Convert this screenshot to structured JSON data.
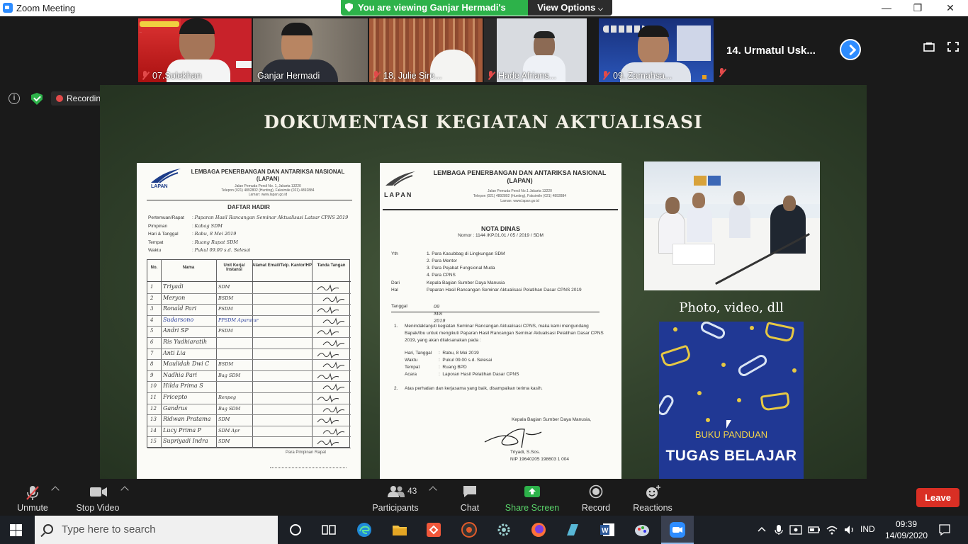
{
  "window": {
    "title": "Zoom Meeting",
    "minimize": "—",
    "maximize": "❐",
    "close": "✕"
  },
  "banner": {
    "viewing_text": "You are viewing Ganjar Hermadi's screen",
    "view_options": "View Options"
  },
  "participants_strip": [
    {
      "name": "07.Solekhan",
      "muted": true
    },
    {
      "name": "Ganjar Hermadi",
      "muted": false,
      "active": true
    },
    {
      "name": "18. Julie Sire...",
      "muted": true
    },
    {
      "name": "Hade Afrians...",
      "muted": true
    },
    {
      "name": "09. Zamahsa...",
      "muted": true
    }
  ],
  "more_participant": "14. Urmatul Usk...",
  "status": {
    "recording": "Recording"
  },
  "slide": {
    "title": "DOKUMENTASI KEGIATAN AKTUALISASI",
    "doc1": {
      "org": "LEMBAGA PENERBANGAN DAN ANTARIKSA NASIONAL",
      "org_abbr": "(LAPAN)",
      "addr1": "Jalan Pemuda Persil No. 1, Jakarta 13220",
      "addr2": "Telepon (021) 4892802 (Hunting), Faksimile (021) 4892884",
      "addr3": "Laman: www.lapan.go.id",
      "logo_text": "LAPAN",
      "heading": "DAFTAR HADIR",
      "fields": [
        {
          "label": "Pertemuan/Rapat",
          "value": "Paparan Hasil Rancangan Seminar Aktualisasi Latsar CPNS 2019"
        },
        {
          "label": "Pimpinan",
          "value": "Kabag SDM"
        },
        {
          "label": "Hari & Tanggal",
          "value": "Rabu, 8 Mei 2019"
        },
        {
          "label": "Tempat",
          "value": "Ruang Rapat SDM"
        },
        {
          "label": "Waktu",
          "value": "Pukul 09.00 s.d. Selesai"
        }
      ],
      "columns": [
        "No.",
        "Nama",
        "Unit Kerja/ Instansi",
        "Alamat Email/Telp. Kantor/HP",
        "Tanda Tangan"
      ],
      "rows": [
        [
          "1",
          "Triyadi",
          "SDM"
        ],
        [
          "2",
          "Meryon",
          "BSDM"
        ],
        [
          "3",
          "Ronald Pari",
          "PSDM"
        ],
        [
          "4",
          "Sudarsono",
          "PPSDM Aparatur"
        ],
        [
          "5",
          "Andri SP",
          "PSDM"
        ],
        [
          "6",
          "Ris Yudhiaratih",
          ""
        ],
        [
          "7",
          "Anti Lia",
          ""
        ],
        [
          "8",
          "Maulidah Dwi C",
          "BSDM"
        ],
        [
          "9",
          "Nadhia Pari",
          "Bag SDM"
        ],
        [
          "10",
          "Hilda Prima S",
          ""
        ],
        [
          "11",
          "Fricepto",
          "Renpeg"
        ],
        [
          "12",
          "Gandrus",
          "Bag SDM"
        ],
        [
          "13",
          "Ridwan Pratama",
          "SDM"
        ],
        [
          "14",
          "Lucy Prima P",
          "SDM Apr"
        ],
        [
          "15",
          "Supriyadi Indra",
          "SDM"
        ]
      ],
      "footer": "Para Pimpinan Rapat"
    },
    "doc2": {
      "org": "LEMBAGA PENERBANGAN DAN ANTARIKSA NASIONAL",
      "org_abbr": "(LAPAN)",
      "addr1": "Jalan Pemuda Persil No.1 Jakarta 13220",
      "addr2": "Telepon (021) 4892802 (Hunting), Faksimile (021) 4892884",
      "addr3": "Laman: www.lapan.go.id",
      "logo_text": "LAPAN",
      "heading": "NOTA DINAS",
      "nomor": "Nomor : 1144 /KP.01.01 / 05 / 2019 / SDM",
      "yth_label": "Yth",
      "yth": [
        "1. Para Kasubbag di Lingkungan SDM",
        "2. Para Mentor",
        "3. Para Pejabat Fungsional Muda",
        "4. Para CPNS"
      ],
      "dari_label": "Dari",
      "dari": "Kepala Bagian Sumber Daya Manusia",
      "hal_label": "Hal",
      "hal": "Paparan Hasil Rancangan Seminar Aktualisasi Pelatihan Dasar CPNS 2019",
      "tanggal_label": "Tanggal",
      "tanggal": "09 Mei 2019",
      "p1": "Menindaklanjuti kegiatan Seminar Rancangan Aktualisasi CPNS, maka kami mengundang Bapak/Ibu untuk mengikuti Paparan Hasil Rancangan Seminar Aktualisasi Pelatihan Dasar CPNS 2019, yang akan dilaksanakan pada :",
      "details": [
        {
          "label": "Hari, Tanggal",
          "value": "Rabu, 8 Mei 2019"
        },
        {
          "label": "Waktu",
          "value": "Pukul 09.00 s.d. Selesai"
        },
        {
          "label": "Tempat",
          "value": "Ruang BPD"
        },
        {
          "label": "Acara",
          "value": "Laporan Hasil Pelatihan Dasar CPNS"
        }
      ],
      "p2": "Atas perhatian dan kerjasama yang baik, disampaikan terima kasih.",
      "signer_title": "Kepala Bagian Sumber Daya Manusia,",
      "signer_name": "Triyadi, S.Sos.",
      "signer_nip": "NIP 19640205 198603 1 004"
    },
    "photo_caption": "Photo, video, dll",
    "book_line1": "BUKU PANDUAN",
    "book_line2": "TUGAS BELAJAR"
  },
  "toolbar": {
    "unmute": "Unmute",
    "stop_video": "Stop Video",
    "participants": "Participants",
    "participants_count": "43",
    "chat": "Chat",
    "share_screen": "Share Screen",
    "record": "Record",
    "reactions": "Reactions",
    "leave": "Leave",
    "share_color": "#2db24a",
    "leave_color": "#d92f24"
  },
  "taskbar": {
    "search_placeholder": "Type here to search",
    "language": "IND",
    "time": "09:39",
    "date": "14/09/2020"
  }
}
